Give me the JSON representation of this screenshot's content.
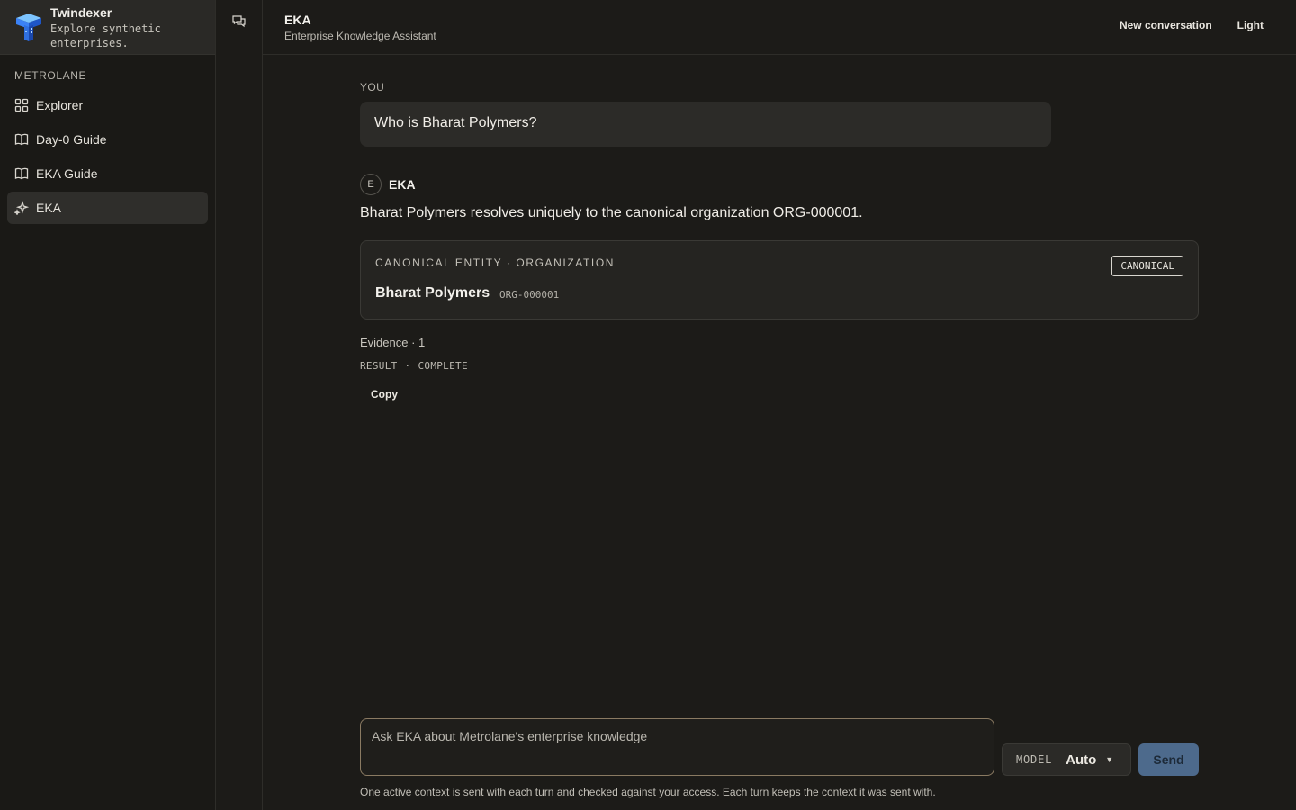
{
  "brand": {
    "name": "Twindexer",
    "tagline": "Explore synthetic enterprises."
  },
  "sidebar": {
    "section": "METROLANE",
    "items": [
      {
        "label": "Explorer",
        "icon": "grid-icon",
        "active": false
      },
      {
        "label": "Day-0 Guide",
        "icon": "book-icon",
        "active": false
      },
      {
        "label": "EKA Guide",
        "icon": "book-icon",
        "active": false
      },
      {
        "label": "EKA",
        "icon": "sparkle-icon",
        "active": true
      }
    ]
  },
  "header": {
    "title": "EKA",
    "subtitle": "Enterprise Knowledge Assistant",
    "new_conversation": "New conversation",
    "theme_toggle": "Light"
  },
  "conversation": {
    "user_label": "YOU",
    "user_message": "Who is Bharat Polymers?",
    "assistant_avatar": "E",
    "assistant_name": "EKA",
    "answer": "Bharat Polymers resolves uniquely to the canonical organization ORG-000001.",
    "entity": {
      "kind": "CANONICAL ENTITY · ORGANIZATION",
      "badge": "CANONICAL",
      "name": "Bharat Polymers",
      "id": "ORG-000001"
    },
    "evidence": "Evidence · 1",
    "result": "RESULT",
    "separator": "·",
    "status": "COMPLETE",
    "copy": "Copy"
  },
  "composer": {
    "placeholder": "Ask EKA about Metrolane's enterprise knowledge",
    "model_label": "MODEL",
    "model_value": "Auto",
    "send": "Send",
    "footnote": "One active context is sent with each turn and checked against your access. Each turn keeps the context it was sent with."
  },
  "colors": {
    "background": "#1c1b18",
    "accent_send": "#4d6a8c",
    "logo_blue": "#3b82f6"
  }
}
